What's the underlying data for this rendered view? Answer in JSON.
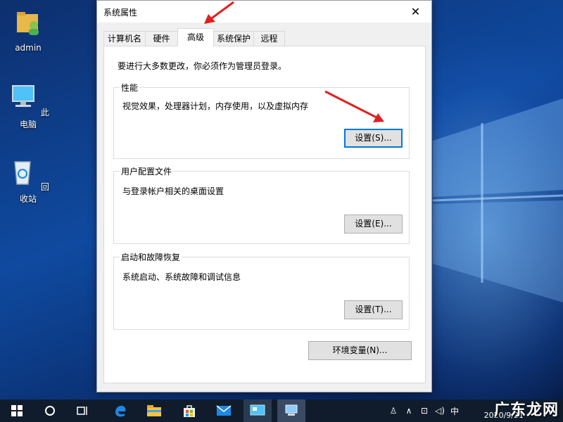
{
  "desktop": {
    "icons": [
      {
        "label": "admin",
        "icon": "user-folder-icon"
      },
      {
        "label": "此电脑",
        "icon": "computer-icon"
      },
      {
        "label": "回收站",
        "icon": "recycle-bin-icon"
      }
    ]
  },
  "dialog": {
    "title": "系统属性",
    "close": "✕",
    "tabs": [
      {
        "label": "计算机名",
        "active": false
      },
      {
        "label": "硬件",
        "active": false
      },
      {
        "label": "高级",
        "active": true
      },
      {
        "label": "系统保护",
        "active": false
      },
      {
        "label": "远程",
        "active": false
      }
    ],
    "notice": "要进行大多数更改，你必须作为管理员登录。",
    "performance": {
      "title": "性能",
      "desc": "视觉效果，处理器计划，内存使用，以及虚拟内存",
      "button": "设置(S)..."
    },
    "profiles": {
      "title": "用户配置文件",
      "desc": "与登录帐户相关的桌面设置",
      "button": "设置(E)..."
    },
    "startup": {
      "title": "启动和故障恢复",
      "desc": "系统启动、系统故障和调试信息",
      "button": "设置(T)..."
    },
    "env_button": "环境变量(N)..."
  },
  "taskbar": {
    "ime": "中",
    "time": "",
    "date": "2020/9/21",
    "watermark": "广东龙网"
  },
  "colors": {
    "accent": "#0078d7",
    "annotation_arrow": "#e02020"
  }
}
